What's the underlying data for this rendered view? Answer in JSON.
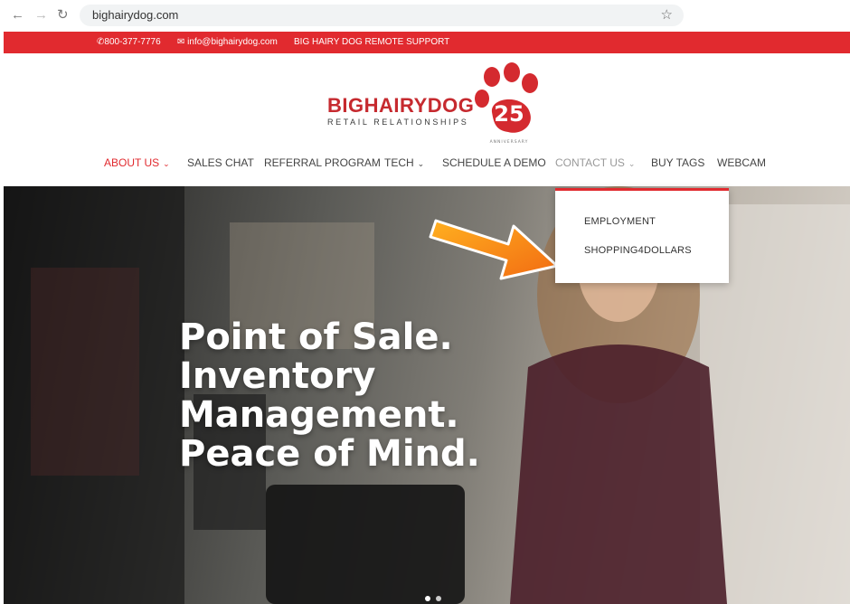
{
  "browser": {
    "back_icon": "back-arrow-icon",
    "forward_icon": "forward-arrow-icon",
    "reload_icon": "reload-icon",
    "url": "bighairydog.com",
    "bookmark_icon": "star-icon"
  },
  "topbar": {
    "phone": "800-377-7776",
    "email": "info@bighairydog.com",
    "support": "BIG HAIRY DOG REMOTE SUPPORT",
    "color": "#e12a2f"
  },
  "logo": {
    "big": "BIG",
    "hairydog": "HAIRYDOG",
    "tagline": "RETAIL RELATIONSHIPS",
    "badge_number": "25",
    "badge_caption": "ANNIVERSARY"
  },
  "nav": {
    "items": [
      {
        "label": "ABOUT US",
        "has_caret": true
      },
      {
        "label": "SALES CHAT"
      },
      {
        "label": "REFERRAL PROGRAM"
      },
      {
        "label": "TECH",
        "has_caret": true
      },
      {
        "label": "SCHEDULE A DEMO"
      },
      {
        "label": "CONTACT US",
        "has_caret": true
      },
      {
        "label": "BUY TAGS"
      },
      {
        "label": "WEBCAM"
      }
    ],
    "caret_glyph": "⌄"
  },
  "dropdown": {
    "items": [
      "EMPLOYMENT",
      "SHOPPING4DOLLARS"
    ]
  },
  "hero": {
    "lines": [
      "Point of Sale.",
      "Inventory",
      "Management.",
      "Peace of Mind."
    ]
  }
}
